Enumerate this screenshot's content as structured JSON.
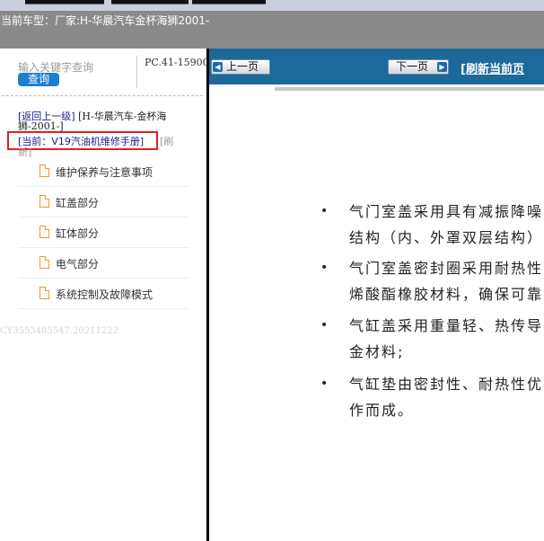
{
  "header": {
    "model_label": "当前车型：",
    "model_value": "厂家:H-华晨汽车金杯海狮2001-"
  },
  "search": {
    "placeholder": "输入关键字查询",
    "button_label": "查询",
    "code": "PC.41-15900"
  },
  "breadcrumb": {
    "back_label": "[返回上一级]",
    "path": "[H-华晨汽车-金杯海狮-2001-]",
    "current_label": "[当前：V19汽油机维修手册]",
    "refresh_a": "[刷",
    "refresh_b": "新]"
  },
  "menu": {
    "items": [
      {
        "label": "维护保养与注意事项"
      },
      {
        "label": "缸盖部分"
      },
      {
        "label": "缸体部分"
      },
      {
        "label": "电气部分"
      },
      {
        "label": "系统控制及故障模式"
      }
    ]
  },
  "footer": {
    "code": "CY3553485547.20211222"
  },
  "toolbar": {
    "prev_label": "上一页",
    "next_label": "下一页",
    "refresh_label": "[刷新当前页"
  },
  "content": {
    "bullets": [
      {
        "lines": [
          "气门室盖采用具有减振降噪",
          "结构（内、外罩双层结构）"
        ]
      },
      {
        "lines": [
          "气门室盖密封圈采用耐热性",
          "烯酸酯橡胶材料，确保可靠"
        ]
      },
      {
        "lines": [
          "气缸盖采用重量轻、热传导",
          "金材料;"
        ]
      },
      {
        "lines": [
          "气缸垫由密封性、耐热性优",
          "作而成。"
        ]
      }
    ]
  },
  "colors": {
    "toolbar_bg": "#1d6a9a",
    "query_button": "#1e7fd0",
    "highlight_border": "#e02020",
    "header_bg": "#8a8a8a"
  }
}
